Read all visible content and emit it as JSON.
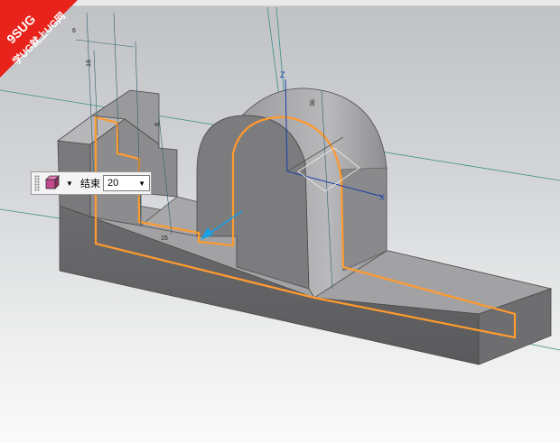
{
  "watermark": {
    "line1": "9SUG",
    "line2": "学UG就上UG网"
  },
  "toolbar": {
    "extent_type_icon": "solid-extrude-icon",
    "end_label": "结束",
    "end_value": "20",
    "dropdown_glyph": "▼"
  },
  "dimensions": {
    "d1": "6",
    "d2": "18",
    "d3": "8",
    "d4": "15",
    "d5": "36"
  },
  "axes": {
    "z": "Z",
    "x": "X"
  },
  "colors": {
    "solid_light": "#8e8e90",
    "solid_dark": "#5e5e60",
    "highlight": "#ff9a2e",
    "vector": "#1aa0e6"
  }
}
